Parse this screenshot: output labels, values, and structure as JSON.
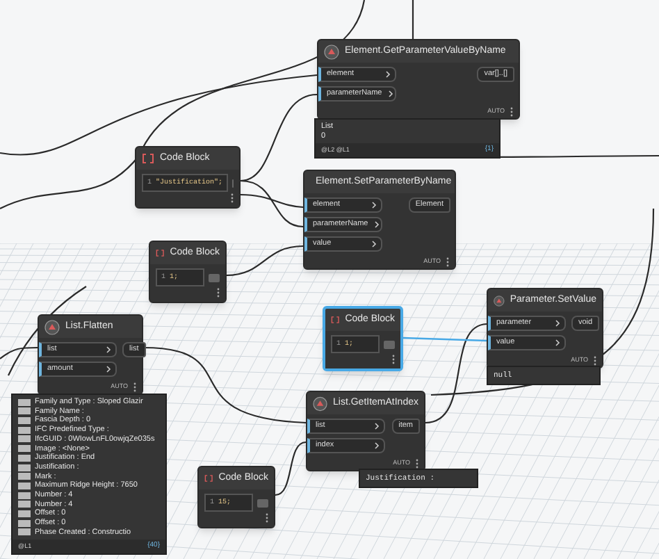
{
  "nodes": [
    {
      "kind": "function",
      "title": "Element.GetParameterValueByName",
      "inputs": [
        "element",
        "parameterName"
      ],
      "outputs": [
        "var[]..[]"
      ],
      "lacing": "AUTO",
      "selected": false,
      "preview": {
        "kind": "list",
        "indexed": false,
        "lines": [
          "List",
          "0"
        ],
        "footer_left": "@L2 @L1",
        "footer_right": "{1}"
      }
    },
    {
      "kind": "code",
      "title": "Code Block",
      "lines": [
        {
          "number": "1",
          "code": "\"Justification\";"
        }
      ],
      "selected": false
    },
    {
      "kind": "function",
      "title": "Element.SetParameterByName",
      "inputs": [
        "element",
        "parameterName",
        "value"
      ],
      "outputs": [
        "Element"
      ],
      "lacing": "AUTO",
      "selected": false
    },
    {
      "kind": "code",
      "title": "Code Block",
      "lines": [
        {
          "number": "1",
          "code": "1;"
        }
      ],
      "selected": false
    },
    {
      "kind": "function",
      "title": "List.Flatten",
      "inputs": [
        "list",
        "amount"
      ],
      "outputs": [
        "list"
      ],
      "lacing": "AUTO",
      "selected": false,
      "preview": {
        "kind": "list",
        "indexed": true,
        "lines": [
          "Family and Type : Sloped Glazir",
          "Family Name :",
          "Fascia Depth : 0",
          "IFC Predefined Type :",
          "IfcGUID : 0WIowLnFL0owjqZe035s",
          "Image : <None>",
          "Justification : End",
          "Justification :",
          "Mark :",
          "Maximum Ridge Height : 7650",
          "Number : 4",
          "Number : 4",
          "Offset : 0",
          "Offset : 0",
          "Phase Created : Constructio"
        ],
        "footer_left": "@L1",
        "footer_right": "{40}"
      }
    },
    {
      "kind": "code",
      "title": "Code Block",
      "lines": [
        {
          "number": "1",
          "code": "1;"
        }
      ],
      "selected": true
    },
    {
      "kind": "function",
      "title": "Parameter.SetValue",
      "inputs": [
        "parameter",
        "value"
      ],
      "outputs": [
        "void"
      ],
      "lacing": "AUTO",
      "selected": false,
      "preview": {
        "kind": "text",
        "lines": [
          "null"
        ]
      }
    },
    {
      "kind": "function",
      "title": "List.GetItemAtIndex",
      "inputs": [
        "list",
        "index"
      ],
      "outputs": [
        "item"
      ],
      "lacing": "AUTO",
      "selected": false,
      "preview": {
        "kind": "text",
        "lines": [
          "Justification :"
        ]
      }
    },
    {
      "kind": "code",
      "title": "Code Block",
      "lines": [
        {
          "number": "1",
          "code": "15;"
        }
      ],
      "selected": false
    }
  ]
}
